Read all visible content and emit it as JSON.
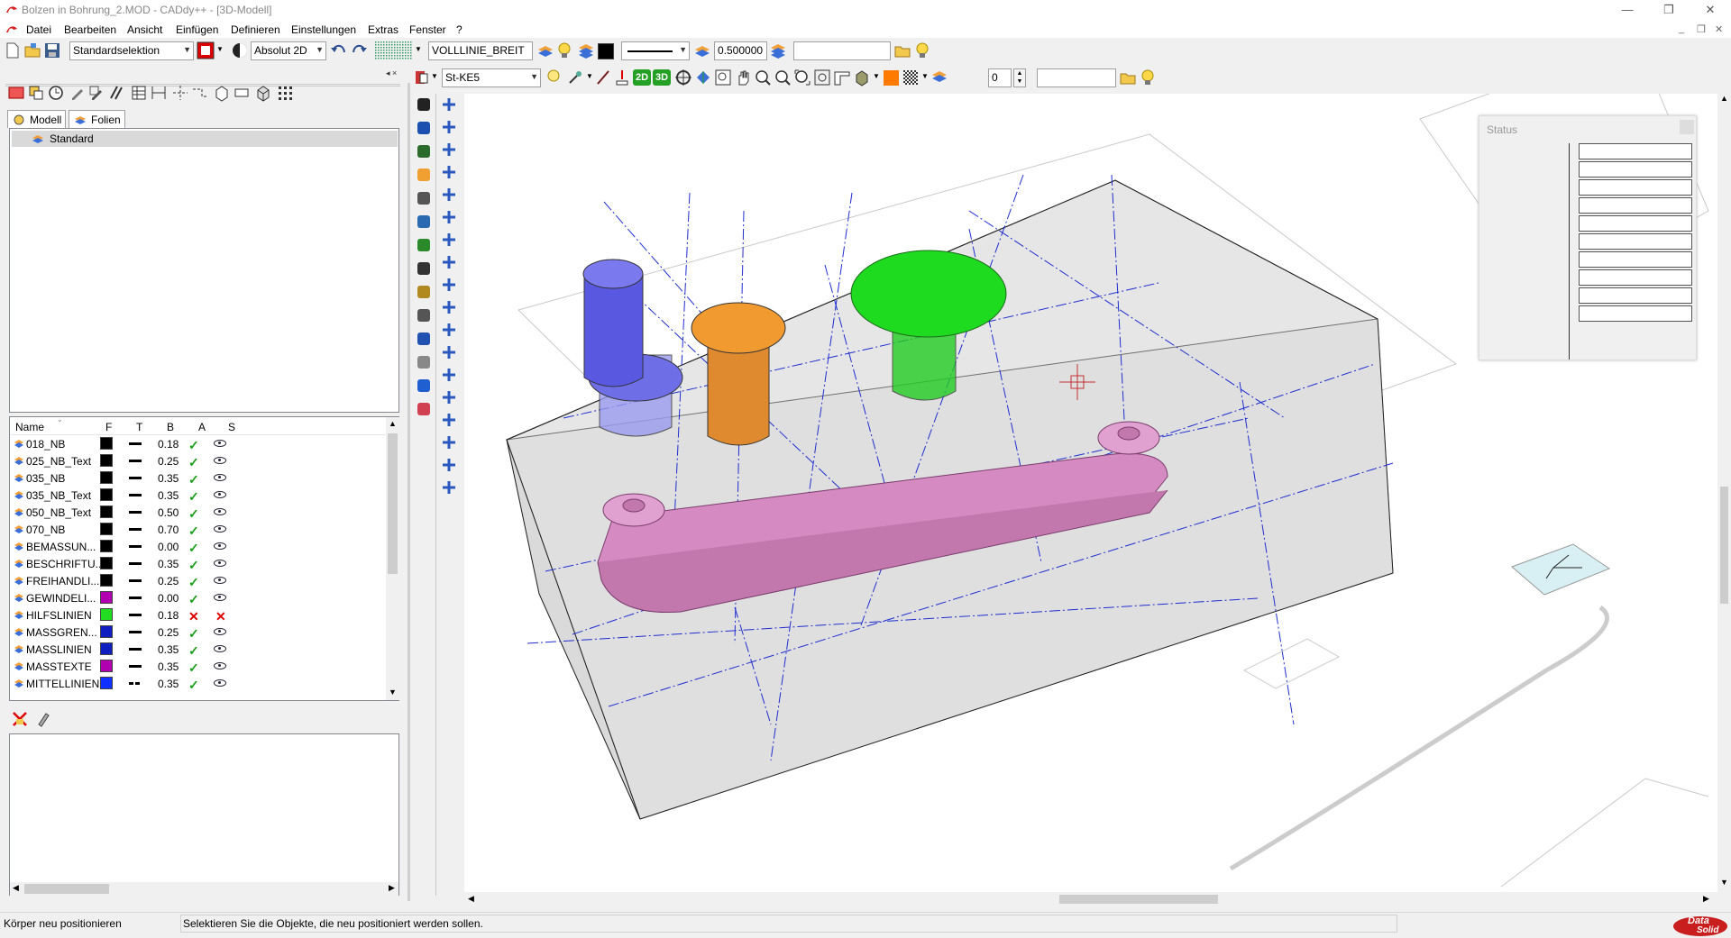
{
  "window": {
    "title": "Bolzen in Bohrung_2.MOD - CADdy++ - [3D-Modell]",
    "controls": [
      "—",
      "❐",
      "✕"
    ],
    "mdi_controls": [
      "_",
      "❐",
      "✕"
    ]
  },
  "menu": [
    "Datei",
    "Bearbeiten",
    "Ansicht",
    "Einfügen",
    "Definieren",
    "Einstellungen",
    "Extras",
    "Fenster",
    "?"
  ],
  "toolbar": {
    "selection_mode": "Standardselektion",
    "coord_mode": "Absolut 2D",
    "linestyle": "VOLLLINIE_BREIT",
    "line_width": "0.500000",
    "search_value": ""
  },
  "toolbar2": {
    "material": "St-KE5",
    "btn_2d": "2D",
    "btn_3d": "3D",
    "layer_number": "0",
    "search_value": ""
  },
  "tabs": {
    "model": "Modell",
    "layers": "Folien"
  },
  "tree": {
    "root": "Standard"
  },
  "layer_table": {
    "columns": [
      "Name",
      "F",
      "T",
      "B",
      "A",
      "S"
    ],
    "rows": [
      {
        "name": "018_NB",
        "color": "#000000",
        "line": "solid",
        "width": "0.18",
        "active": true,
        "visible": true
      },
      {
        "name": "025_NB_Text",
        "color": "#000000",
        "line": "solid",
        "width": "0.25",
        "active": true,
        "visible": true
      },
      {
        "name": "035_NB",
        "color": "#000000",
        "line": "solid",
        "width": "0.35",
        "active": true,
        "visible": true
      },
      {
        "name": "035_NB_Text",
        "color": "#000000",
        "line": "solid",
        "width": "0.35",
        "active": true,
        "visible": true
      },
      {
        "name": "050_NB_Text",
        "color": "#000000",
        "line": "solid",
        "width": "0.50",
        "active": true,
        "visible": true
      },
      {
        "name": "070_NB",
        "color": "#000000",
        "line": "solid",
        "width": "0.70",
        "active": true,
        "visible": true
      },
      {
        "name": "BEMASSUN...",
        "color": "#000000",
        "line": "solid",
        "width": "0.00",
        "active": true,
        "visible": true
      },
      {
        "name": "BESCHRIFTU...",
        "color": "#000000",
        "line": "solid",
        "width": "0.35",
        "active": true,
        "visible": true
      },
      {
        "name": "FREIHANDLI...",
        "color": "#000000",
        "line": "solid",
        "width": "0.25",
        "active": true,
        "visible": true
      },
      {
        "name": "GEWINDELI...",
        "color": "#b000b0",
        "line": "solid",
        "width": "0.00",
        "active": true,
        "visible": true
      },
      {
        "name": "HILFSLINIEN",
        "color": "#22dd22",
        "line": "solid",
        "width": "0.18",
        "active": false,
        "visible": false
      },
      {
        "name": "MASSGREN...",
        "color": "#1020c0",
        "line": "solid",
        "width": "0.25",
        "active": true,
        "visible": true
      },
      {
        "name": "MASSLINIEN",
        "color": "#1020c0",
        "line": "solid",
        "width": "0.35",
        "active": true,
        "visible": true
      },
      {
        "name": "MASSTEXTE",
        "color": "#b000b0",
        "line": "solid",
        "width": "0.35",
        "active": true,
        "visible": true
      },
      {
        "name": "MITTELLINIEN",
        "color": "#1030ff",
        "line": "dashdot",
        "width": "0.35",
        "active": true,
        "visible": true
      }
    ]
  },
  "status_window": {
    "title": "Status"
  },
  "statusbar": {
    "left": "Körper neu positionieren",
    "message": "Selektieren Sie die Objekte, die neu positioniert werden sollen."
  },
  "brand": {
    "top": "Data",
    "bottom": "Solid"
  },
  "colors": {
    "pin_blue": "#5858e0",
    "pin_orange": "#e08a30",
    "pin_green": "#22cc22",
    "lever_pink": "#d68ac2",
    "centerline": "#1e2ed0"
  }
}
